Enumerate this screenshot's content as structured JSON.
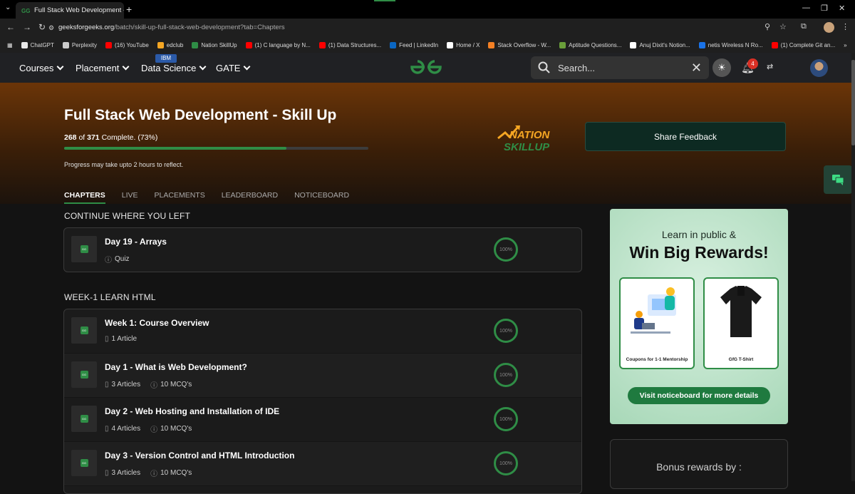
{
  "browser": {
    "tab_title": "Full Stack Web Development - S",
    "url_domain": "geeksforgeeks.org",
    "url_path": "/batch/skill-up-full-stack-web-development?tab=Chapters",
    "bookmarks": [
      {
        "label": "ChatGPT",
        "color": "#e8e8e8"
      },
      {
        "label": "Perplexity",
        "color": "#cccccc"
      },
      {
        "label": "(16) YouTube",
        "color": "#ff0000"
      },
      {
        "label": "edclub",
        "color": "#f5a623"
      },
      {
        "label": "Nation SkillUp",
        "color": "#2f8d46"
      },
      {
        "label": "(1) C language by N...",
        "color": "#ff0000"
      },
      {
        "label": "(1) Data Structures...",
        "color": "#ff0000"
      },
      {
        "label": "Feed | LinkedIn",
        "color": "#0a66c2"
      },
      {
        "label": "Home / X",
        "color": "#ffffff"
      },
      {
        "label": "Stack Overflow - W...",
        "color": "#f48024"
      },
      {
        "label": "Aptitude Questions...",
        "color": "#6a9f3a"
      },
      {
        "label": "Anuj Dixit's Notion...",
        "color": "#ffffff"
      },
      {
        "label": "netis Wireless N Ro...",
        "color": "#1a73e8"
      },
      {
        "label": "(1) Complete Git an...",
        "color": "#ff0000"
      }
    ]
  },
  "header": {
    "menu": [
      "Courses",
      "Placement",
      "Data Science",
      "GATE"
    ],
    "ibm_badge": "IBM",
    "search_placeholder": "Search...",
    "notification_count": "4"
  },
  "hero": {
    "title": "Full Stack Web Development - Skill Up",
    "progress_done": "268",
    "progress_of": " of ",
    "progress_total": "371",
    "progress_suffix": " Complete. (73%)",
    "progress_fraction": 0.73,
    "note": "Progress may take upto 2 hours to reflect.",
    "feedback_label": "Share Feedback",
    "tabs": [
      "CHAPTERS",
      "LIVE",
      "PLACEMENTS",
      "LEADERBOARD",
      "NOTICEBOARD"
    ]
  },
  "continue": {
    "section_title": "CONTINUE WHERE YOU LEFT",
    "item": {
      "title": "Day 19 - Arrays",
      "meta": "Quiz",
      "percent": "100%"
    }
  },
  "week1": {
    "section_title": "WEEK-1 LEARN HTML",
    "items": [
      {
        "title": "Week 1: Course Overview",
        "articles": "1 Article",
        "mcqs": "",
        "percent": "100%"
      },
      {
        "title": "Day 1 - What is Web Development?",
        "articles": "3 Articles",
        "mcqs": "10 MCQ's",
        "percent": "100%"
      },
      {
        "title": "Day 2 - Web Hosting and Installation of IDE",
        "articles": "4 Articles",
        "mcqs": "10 MCQ's",
        "percent": "100%"
      },
      {
        "title": "Day 3 - Version Control and HTML Introduction",
        "articles": "3 Articles",
        "mcqs": "10 MCQ's",
        "percent": "100%"
      }
    ]
  },
  "promo": {
    "line1": "Learn in public &",
    "line2": "Win Big Rewards!",
    "card1_caption": "Coupons for 1-1 Mentorship",
    "card2_caption": "GfG T-Shirt",
    "button": "Visit noticeboard for more details"
  },
  "bonus": {
    "title": "Bonus rewards by :"
  },
  "colors": {
    "accent": "#2f8d46",
    "hero_top": "#6b3508"
  }
}
